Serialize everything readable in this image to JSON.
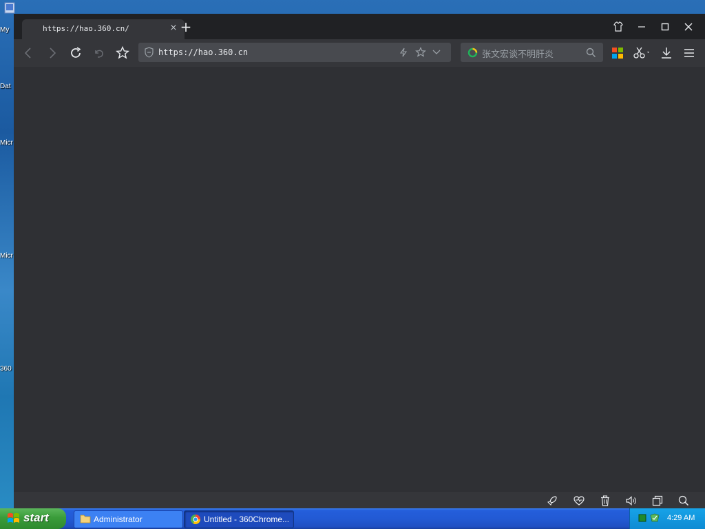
{
  "desktop": {
    "icons": [
      {
        "label": "My"
      },
      {
        "label": "Dat"
      },
      {
        "label": "Micr"
      },
      {
        "label": "Micr"
      },
      {
        "label": "360"
      }
    ]
  },
  "browser": {
    "tab": {
      "title": "https://hao.360.cn/",
      "close_glyph": "×"
    },
    "new_tab_glyph": "+",
    "address": {
      "url": "https://hao.360.cn"
    },
    "search": {
      "placeholder": "张文宏谈不明肝炎"
    }
  },
  "taskbar": {
    "start_label": "start",
    "tasks": [
      {
        "label": "Administrator",
        "icon": "folder-icon"
      },
      {
        "label": "Untitled - 360Chrome...",
        "icon": "360chrome-icon"
      }
    ],
    "clock": "4:29 AM"
  },
  "colors": {
    "content_bg": "#2f3034",
    "toolbar_bg": "#35363a",
    "tabbar_bg": "#202124",
    "taskbar_blue": "#245edb",
    "start_green": "#3a9c3a"
  }
}
